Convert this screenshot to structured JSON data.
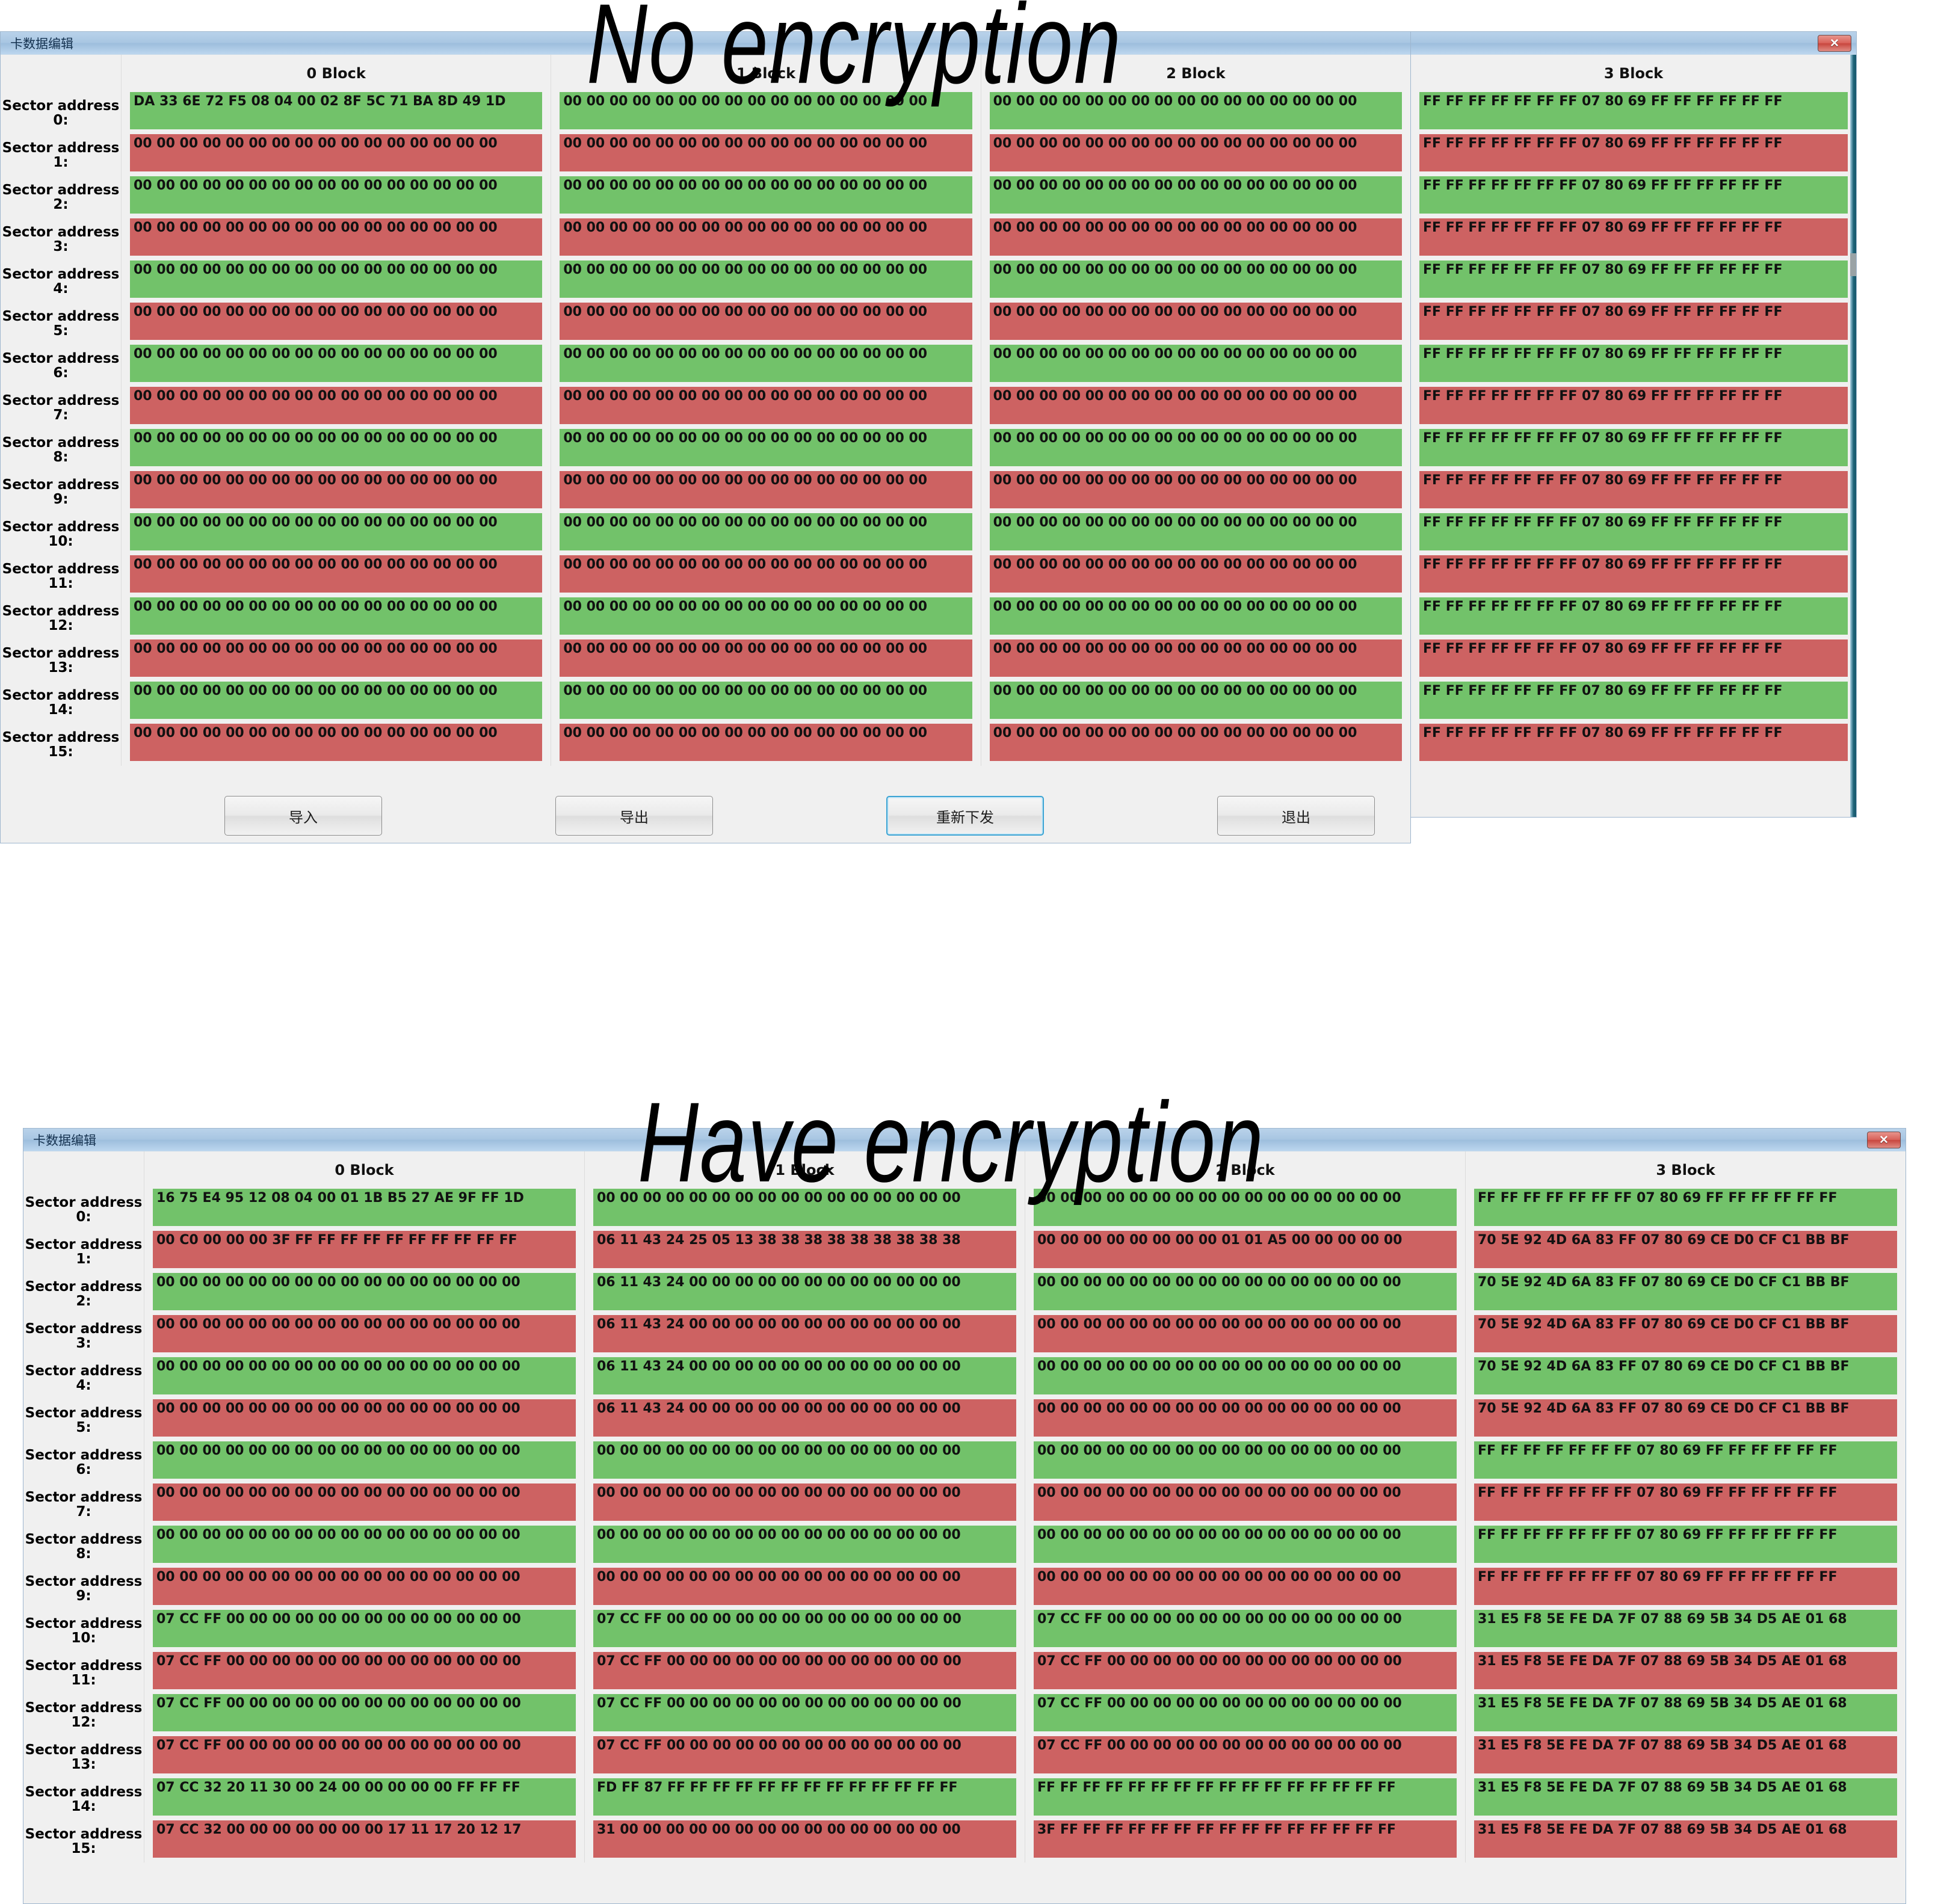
{
  "captions": {
    "no_encryption": "No encryption",
    "have_encryption": "Have encryption"
  },
  "colors": {
    "green_row": "#72c26a",
    "red_row": "#cd6262",
    "titlebar": "#a8c6e2",
    "window_bg": "#f0f0f0",
    "close_button": "#d9625a",
    "focus_accent": "#3ba4d4"
  },
  "window_no_encryption": {
    "title": "卡数据编辑",
    "close_label": "✕",
    "block_headers": [
      "0 Block",
      "1 Block",
      "2 Block",
      "3 Block"
    ],
    "address_label_prefix": "Sector address",
    "rows": [
      {
        "address": "Sector address 0:",
        "address_line1": "Sector address",
        "address_line2": "0:",
        "color": "green",
        "blocks": [
          "DA 33 6E 72 F5 08 04 00 02 8F 5C 71 BA 8D 49 1D",
          "00 00 00 00 00 00 00 00 00 00 00 00 00 00 00 00",
          "00 00 00 00 00 00 00 00 00 00 00 00 00 00 00 00",
          "FF FF FF FF FF FF FF 07 80 69 FF FF FF FF FF FF"
        ]
      },
      {
        "address": "Sector address 1:",
        "address_line1": "Sector address",
        "address_line2": "1:",
        "color": "red",
        "blocks": [
          "00 00 00 00 00 00 00 00 00 00 00 00 00 00 00 00",
          "00 00 00 00 00 00 00 00 00 00 00 00 00 00 00 00",
          "00 00 00 00 00 00 00 00 00 00 00 00 00 00 00 00",
          "FF FF FF FF FF FF FF 07 80 69 FF FF FF FF FF FF"
        ]
      },
      {
        "address": "Sector address 2:",
        "address_line1": "Sector address",
        "address_line2": "2:",
        "color": "green",
        "blocks": [
          "00 00 00 00 00 00 00 00 00 00 00 00 00 00 00 00",
          "00 00 00 00 00 00 00 00 00 00 00 00 00 00 00 00",
          "00 00 00 00 00 00 00 00 00 00 00 00 00 00 00 00",
          "FF FF FF FF FF FF FF 07 80 69 FF FF FF FF FF FF"
        ]
      },
      {
        "address": "Sector address 3:",
        "address_line1": "Sector address",
        "address_line2": "3:",
        "color": "red",
        "blocks": [
          "00 00 00 00 00 00 00 00 00 00 00 00 00 00 00 00",
          "00 00 00 00 00 00 00 00 00 00 00 00 00 00 00 00",
          "00 00 00 00 00 00 00 00 00 00 00 00 00 00 00 00",
          "FF FF FF FF FF FF FF 07 80 69 FF FF FF FF FF FF"
        ]
      },
      {
        "address": "Sector address 4:",
        "address_line1": "Sector address",
        "address_line2": "4:",
        "color": "green",
        "blocks": [
          "00 00 00 00 00 00 00 00 00 00 00 00 00 00 00 00",
          "00 00 00 00 00 00 00 00 00 00 00 00 00 00 00 00",
          "00 00 00 00 00 00 00 00 00 00 00 00 00 00 00 00",
          "FF FF FF FF FF FF FF 07 80 69 FF FF FF FF FF FF"
        ]
      },
      {
        "address": "Sector address 5:",
        "address_line1": "Sector address",
        "address_line2": "5:",
        "color": "red",
        "blocks": [
          "00 00 00 00 00 00 00 00 00 00 00 00 00 00 00 00",
          "00 00 00 00 00 00 00 00 00 00 00 00 00 00 00 00",
          "00 00 00 00 00 00 00 00 00 00 00 00 00 00 00 00",
          "FF FF FF FF FF FF FF 07 80 69 FF FF FF FF FF FF"
        ]
      },
      {
        "address": "Sector address 6:",
        "address_line1": "Sector address",
        "address_line2": "6:",
        "color": "green",
        "blocks": [
          "00 00 00 00 00 00 00 00 00 00 00 00 00 00 00 00",
          "00 00 00 00 00 00 00 00 00 00 00 00 00 00 00 00",
          "00 00 00 00 00 00 00 00 00 00 00 00 00 00 00 00",
          "FF FF FF FF FF FF FF 07 80 69 FF FF FF FF FF FF"
        ]
      },
      {
        "address": "Sector address 7:",
        "address_line1": "Sector address",
        "address_line2": "7:",
        "color": "red",
        "blocks": [
          "00 00 00 00 00 00 00 00 00 00 00 00 00 00 00 00",
          "00 00 00 00 00 00 00 00 00 00 00 00 00 00 00 00",
          "00 00 00 00 00 00 00 00 00 00 00 00 00 00 00 00",
          "FF FF FF FF FF FF FF 07 80 69 FF FF FF FF FF FF"
        ]
      },
      {
        "address": "Sector address 8:",
        "address_line1": "Sector address",
        "address_line2": "8:",
        "color": "green",
        "blocks": [
          "00 00 00 00 00 00 00 00 00 00 00 00 00 00 00 00",
          "00 00 00 00 00 00 00 00 00 00 00 00 00 00 00 00",
          "00 00 00 00 00 00 00 00 00 00 00 00 00 00 00 00",
          "FF FF FF FF FF FF FF 07 80 69 FF FF FF FF FF FF"
        ]
      },
      {
        "address": "Sector address 9:",
        "address_line1": "Sector address",
        "address_line2": "9:",
        "color": "red",
        "blocks": [
          "00 00 00 00 00 00 00 00 00 00 00 00 00 00 00 00",
          "00 00 00 00 00 00 00 00 00 00 00 00 00 00 00 00",
          "00 00 00 00 00 00 00 00 00 00 00 00 00 00 00 00",
          "FF FF FF FF FF FF FF 07 80 69 FF FF FF FF FF FF"
        ]
      },
      {
        "address": "Sector address 10:",
        "address_line1": "Sector address",
        "address_line2": "10:",
        "color": "green",
        "blocks": [
          "00 00 00 00 00 00 00 00 00 00 00 00 00 00 00 00",
          "00 00 00 00 00 00 00 00 00 00 00 00 00 00 00 00",
          "00 00 00 00 00 00 00 00 00 00 00 00 00 00 00 00",
          "FF FF FF FF FF FF FF 07 80 69 FF FF FF FF FF FF"
        ]
      },
      {
        "address": "Sector address 11:",
        "address_line1": "Sector address",
        "address_line2": "11:",
        "color": "red",
        "blocks": [
          "00 00 00 00 00 00 00 00 00 00 00 00 00 00 00 00",
          "00 00 00 00 00 00 00 00 00 00 00 00 00 00 00 00",
          "00 00 00 00 00 00 00 00 00 00 00 00 00 00 00 00",
          "FF FF FF FF FF FF FF 07 80 69 FF FF FF FF FF FF"
        ]
      },
      {
        "address": "Sector address 12:",
        "address_line1": "Sector address",
        "address_line2": "12:",
        "color": "green",
        "blocks": [
          "00 00 00 00 00 00 00 00 00 00 00 00 00 00 00 00",
          "00 00 00 00 00 00 00 00 00 00 00 00 00 00 00 00",
          "00 00 00 00 00 00 00 00 00 00 00 00 00 00 00 00",
          "FF FF FF FF FF FF FF 07 80 69 FF FF FF FF FF FF"
        ]
      },
      {
        "address": "Sector address 13:",
        "address_line1": "Sector address",
        "address_line2": "13:",
        "color": "red",
        "blocks": [
          "00 00 00 00 00 00 00 00 00 00 00 00 00 00 00 00",
          "00 00 00 00 00 00 00 00 00 00 00 00 00 00 00 00",
          "00 00 00 00 00 00 00 00 00 00 00 00 00 00 00 00",
          "FF FF FF FF FF FF FF 07 80 69 FF FF FF FF FF FF"
        ]
      },
      {
        "address": "Sector address 14:",
        "address_line1": "Sector address",
        "address_line2": "14:",
        "color": "green",
        "blocks": [
          "00 00 00 00 00 00 00 00 00 00 00 00 00 00 00 00",
          "00 00 00 00 00 00 00 00 00 00 00 00 00 00 00 00",
          "00 00 00 00 00 00 00 00 00 00 00 00 00 00 00 00",
          "FF FF FF FF FF FF FF 07 80 69 FF FF FF FF FF FF"
        ]
      },
      {
        "address": "Sector address 15:",
        "address_line1": "Sector address",
        "address_line2": "15:",
        "color": "red",
        "blocks": [
          "00 00 00 00 00 00 00 00 00 00 00 00 00 00 00 00",
          "00 00 00 00 00 00 00 00 00 00 00 00 00 00 00 00",
          "00 00 00 00 00 00 00 00 00 00 00 00 00 00 00 00",
          "FF FF FF FF FF FF FF 07 80 69 FF FF FF FF FF FF"
        ]
      }
    ],
    "buttons": [
      {
        "label": "导入",
        "focused": false
      },
      {
        "label": "导出",
        "focused": false
      },
      {
        "label": "重新下发",
        "focused": true
      },
      {
        "label": "退出",
        "focused": false
      }
    ]
  },
  "window_have_encryption": {
    "title": "卡数据编辑",
    "close_label": "✕",
    "block_headers": [
      "0 Block",
      "1 Block",
      "2 Block",
      "3 Block"
    ],
    "address_label_prefix": "Sector address",
    "rows": [
      {
        "address": "Sector address 0:",
        "address_line1": "Sector address",
        "address_line2": "0:",
        "color": "green",
        "blocks": [
          "16 75 E4 95 12 08 04 00 01 1B B5 27 AE 9F FF 1D",
          "00 00 00 00 00 00 00 00 00 00 00 00 00 00 00 00",
          "00 00 00 00 00 00 00 00 00 00 00 00 00 00 00 00",
          "FF FF FF FF FF FF FF 07 80 69 FF FF FF FF FF FF"
        ]
      },
      {
        "address": "Sector address 1:",
        "address_line1": "Sector address",
        "address_line2": "1:",
        "color": "red",
        "blocks": [
          "00 C0 00 00 00 3F FF FF FF FF FF FF FF FF FF FF",
          "06 11 43 24 25 05 13 38 38 38 38 38 38 38 38 38",
          "00 00 00 00 00 00 00 00 01 01 A5 00 00 00 00 00",
          "70 5E 92 4D 6A 83 FF 07 80 69 CE D0 CF C1 BB BF"
        ]
      },
      {
        "address": "Sector address 2:",
        "address_line1": "Sector address",
        "address_line2": "2:",
        "color": "green",
        "blocks": [
          "00 00 00 00 00 00 00 00 00 00 00 00 00 00 00 00",
          "06 11 43 24 00 00 00 00 00 00 00 00 00 00 00 00",
          "00 00 00 00 00 00 00 00 00 00 00 00 00 00 00 00",
          "70 5E 92 4D 6A 83 FF 07 80 69 CE D0 CF C1 BB BF"
        ]
      },
      {
        "address": "Sector address 3:",
        "address_line1": "Sector address",
        "address_line2": "3:",
        "color": "red",
        "blocks": [
          "00 00 00 00 00 00 00 00 00 00 00 00 00 00 00 00",
          "06 11 43 24 00 00 00 00 00 00 00 00 00 00 00 00",
          "00 00 00 00 00 00 00 00 00 00 00 00 00 00 00 00",
          "70 5E 92 4D 6A 83 FF 07 80 69 CE D0 CF C1 BB BF"
        ]
      },
      {
        "address": "Sector address 4:",
        "address_line1": "Sector address",
        "address_line2": "4:",
        "color": "green",
        "blocks": [
          "00 00 00 00 00 00 00 00 00 00 00 00 00 00 00 00",
          "06 11 43 24 00 00 00 00 00 00 00 00 00 00 00 00",
          "00 00 00 00 00 00 00 00 00 00 00 00 00 00 00 00",
          "70 5E 92 4D 6A 83 FF 07 80 69 CE D0 CF C1 BB BF"
        ]
      },
      {
        "address": "Sector address 5:",
        "address_line1": "Sector address",
        "address_line2": "5:",
        "color": "red",
        "blocks": [
          "00 00 00 00 00 00 00 00 00 00 00 00 00 00 00 00",
          "06 11 43 24 00 00 00 00 00 00 00 00 00 00 00 00",
          "00 00 00 00 00 00 00 00 00 00 00 00 00 00 00 00",
          "70 5E 92 4D 6A 83 FF 07 80 69 CE D0 CF C1 BB BF"
        ]
      },
      {
        "address": "Sector address 6:",
        "address_line1": "Sector address",
        "address_line2": "6:",
        "color": "green",
        "blocks": [
          "00 00 00 00 00 00 00 00 00 00 00 00 00 00 00 00",
          "00 00 00 00 00 00 00 00 00 00 00 00 00 00 00 00",
          "00 00 00 00 00 00 00 00 00 00 00 00 00 00 00 00",
          "FF FF FF FF FF FF FF 07 80 69 FF FF FF FF FF FF"
        ]
      },
      {
        "address": "Sector address 7:",
        "address_line1": "Sector address",
        "address_line2": "7:",
        "color": "red",
        "blocks": [
          "00 00 00 00 00 00 00 00 00 00 00 00 00 00 00 00",
          "00 00 00 00 00 00 00 00 00 00 00 00 00 00 00 00",
          "00 00 00 00 00 00 00 00 00 00 00 00 00 00 00 00",
          "FF FF FF FF FF FF FF 07 80 69 FF FF FF FF FF FF"
        ]
      },
      {
        "address": "Sector address 8:",
        "address_line1": "Sector address",
        "address_line2": "8:",
        "color": "green",
        "blocks": [
          "00 00 00 00 00 00 00 00 00 00 00 00 00 00 00 00",
          "00 00 00 00 00 00 00 00 00 00 00 00 00 00 00 00",
          "00 00 00 00 00 00 00 00 00 00 00 00 00 00 00 00",
          "FF FF FF FF FF FF FF 07 80 69 FF FF FF FF FF FF"
        ]
      },
      {
        "address": "Sector address 9:",
        "address_line1": "Sector address",
        "address_line2": "9:",
        "color": "red",
        "blocks": [
          "00 00 00 00 00 00 00 00 00 00 00 00 00 00 00 00",
          "00 00 00 00 00 00 00 00 00 00 00 00 00 00 00 00",
          "00 00 00 00 00 00 00 00 00 00 00 00 00 00 00 00",
          "FF FF FF FF FF FF FF 07 80 69 FF FF FF FF FF FF"
        ]
      },
      {
        "address": "Sector address 10:",
        "address_line1": "Sector address",
        "address_line2": "10:",
        "color": "green",
        "blocks": [
          "07 CC FF 00 00 00 00 00 00 00 00 00 00 00 00 00",
          "07 CC FF 00 00 00 00 00 00 00 00 00 00 00 00 00",
          "07 CC FF 00 00 00 00 00 00 00 00 00 00 00 00 00",
          "31 E5 F8 5E FE DA 7F 07 88 69 5B 34 D5 AE 01 68"
        ]
      },
      {
        "address": "Sector address 11:",
        "address_line1": "Sector address",
        "address_line2": "11:",
        "color": "red",
        "blocks": [
          "07 CC FF 00 00 00 00 00 00 00 00 00 00 00 00 00",
          "07 CC FF 00 00 00 00 00 00 00 00 00 00 00 00 00",
          "07 CC FF 00 00 00 00 00 00 00 00 00 00 00 00 00",
          "31 E5 F8 5E FE DA 7F 07 88 69 5B 34 D5 AE 01 68"
        ]
      },
      {
        "address": "Sector address 12:",
        "address_line1": "Sector address",
        "address_line2": "12:",
        "color": "green",
        "blocks": [
          "07 CC FF 00 00 00 00 00 00 00 00 00 00 00 00 00",
          "07 CC FF 00 00 00 00 00 00 00 00 00 00 00 00 00",
          "07 CC FF 00 00 00 00 00 00 00 00 00 00 00 00 00",
          "31 E5 F8 5E FE DA 7F 07 88 69 5B 34 D5 AE 01 68"
        ]
      },
      {
        "address": "Sector address 13:",
        "address_line1": "Sector address",
        "address_line2": "13:",
        "color": "red",
        "blocks": [
          "07 CC FF 00 00 00 00 00 00 00 00 00 00 00 00 00",
          "07 CC FF 00 00 00 00 00 00 00 00 00 00 00 00 00",
          "07 CC FF 00 00 00 00 00 00 00 00 00 00 00 00 00",
          "31 E5 F8 5E FE DA 7F 07 88 69 5B 34 D5 AE 01 68"
        ]
      },
      {
        "address": "Sector address 14:",
        "address_line1": "Sector address",
        "address_line2": "14:",
        "color": "green",
        "blocks": [
          "07 CC 32 20 11 30 00 24 00 00 00 00 00 FF FF FF",
          "FD FF 87 FF FF FF FF FF FF FF FF FF FF FF FF FF",
          "FF FF FF FF FF FF FF FF FF FF FF FF FF FF FF FF",
          "31 E5 F8 5E FE DA 7F 07 88 69 5B 34 D5 AE 01 68"
        ]
      },
      {
        "address": "Sector address 15:",
        "address_line1": "Sector address",
        "address_line2": "15:",
        "color": "red",
        "blocks": [
          "07 CC 32 00 00 00 00 00 00 00 17 11 17 20 12 17",
          "31 00 00 00 00 00 00 00 00 00 00 00 00 00 00 00",
          "3F FF FF FF FF FF FF FF FF FF FF FF FF FF FF FF",
          "31 E5 F8 5E FE DA 7F 07 88 69 5B 34 D5 AE 01 68"
        ]
      }
    ]
  }
}
